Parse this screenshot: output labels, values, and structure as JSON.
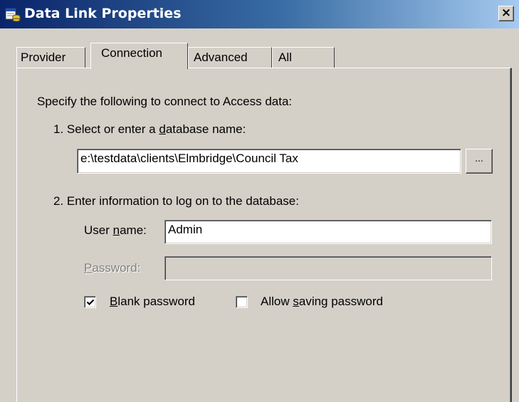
{
  "window": {
    "title": "Data Link Properties",
    "icon": "data-link-icon",
    "close_label": "×"
  },
  "tabs": [
    {
      "label": "Provider",
      "active": false
    },
    {
      "label": "Connection",
      "active": true
    },
    {
      "label": "Advanced",
      "active": false
    },
    {
      "label": "All",
      "active": false
    }
  ],
  "connection": {
    "intro": "Specify the following to connect to Access data:",
    "step1": {
      "prefix": "1. Select or enter a ",
      "accel": "d",
      "suffix": "atabase name:"
    },
    "database_value": "e:\\testdata\\clients\\Elmbridge\\Council Tax",
    "browse_label": "...",
    "step2": "2. Enter information to log on to the database:",
    "username": {
      "prefix": "User ",
      "accel": "n",
      "suffix": "ame:",
      "value": "Admin"
    },
    "password": {
      "accel": "P",
      "suffix": "assword:",
      "value": "",
      "enabled": false
    },
    "blank_password": {
      "accel": "B",
      "suffix": "lank password",
      "checked": true
    },
    "allow_saving": {
      "prefix": "Allow ",
      "accel": "s",
      "suffix": "aving password",
      "checked": false
    }
  }
}
